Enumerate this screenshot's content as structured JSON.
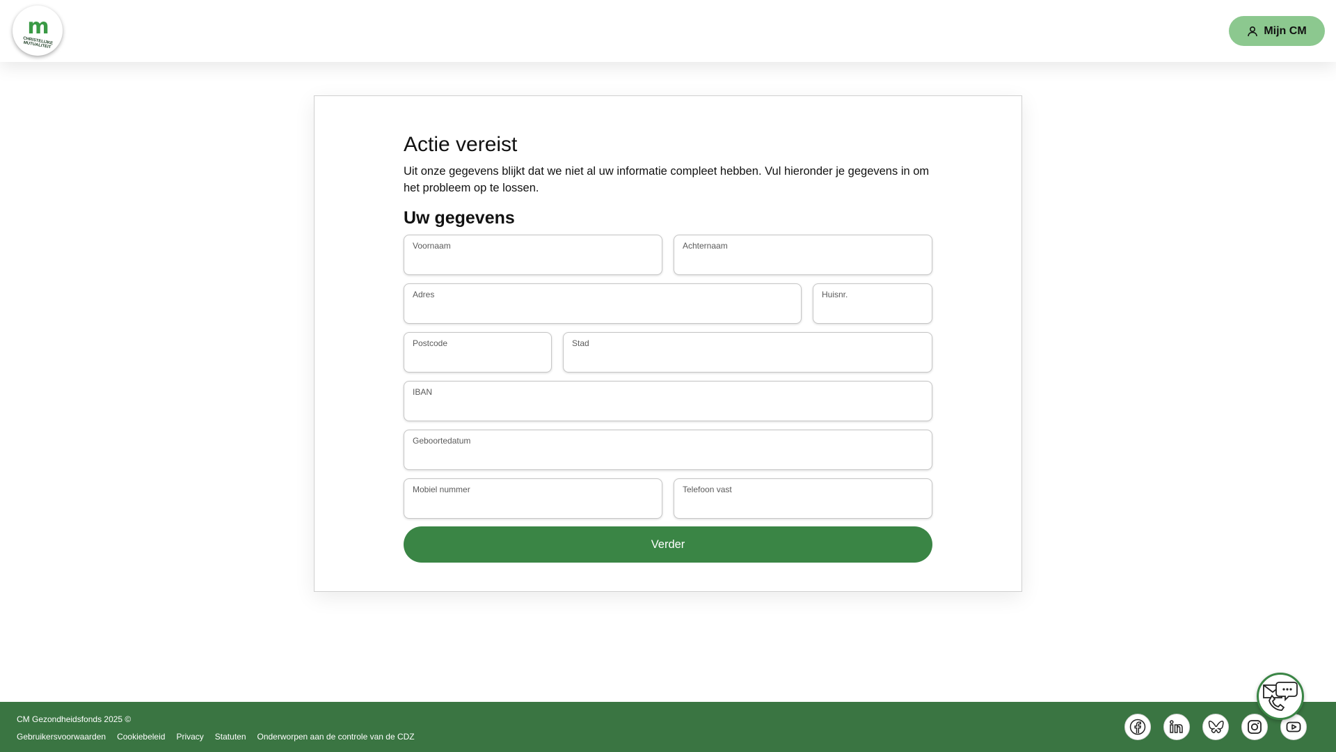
{
  "header": {
    "logo_mark": "m",
    "logo_text": "CHRISTELIJKE MUTUALITEIT",
    "account_button": "Mijn CM"
  },
  "form": {
    "title": "Actie vereist",
    "intro": "Uit onze gegevens blijkt dat we niet al uw informatie compleet hebben. Vul hieronder je gegevens in om het probleem op te lossen.",
    "section_title": "Uw gegevens",
    "fields": {
      "voornaam": {
        "label": "Voornaam",
        "value": ""
      },
      "achternaam": {
        "label": "Achternaam",
        "value": ""
      },
      "adres": {
        "label": "Adres",
        "value": ""
      },
      "huisnr": {
        "label": "Huisnr.",
        "value": ""
      },
      "postcode": {
        "label": "Postcode",
        "value": ""
      },
      "stad": {
        "label": "Stad",
        "value": ""
      },
      "iban": {
        "label": "IBAN",
        "value": ""
      },
      "geboortedatum": {
        "label": "Geboortedatum",
        "value": ""
      },
      "mobiel": {
        "label": "Mobiel nummer",
        "value": ""
      },
      "telefoon": {
        "label": "Telefoon vast",
        "value": ""
      }
    },
    "submit_label": "Verder"
  },
  "footer": {
    "copyright": "CM Gezondheidsfonds 2025 ©",
    "links": [
      "Gebruikersvoorwaarden",
      "Cookiebeleid",
      "Privacy",
      "Statuten",
      "Onderworpen aan de controle van de CDZ"
    ],
    "socials": [
      "facebook-icon",
      "linkedin-icon",
      "bluesky-icon",
      "instagram-icon",
      "youtube-icon"
    ]
  },
  "colors": {
    "brand_green": "#3a8545",
    "footer_green": "#3a7542",
    "account_button_bg": "#8cc88f"
  }
}
